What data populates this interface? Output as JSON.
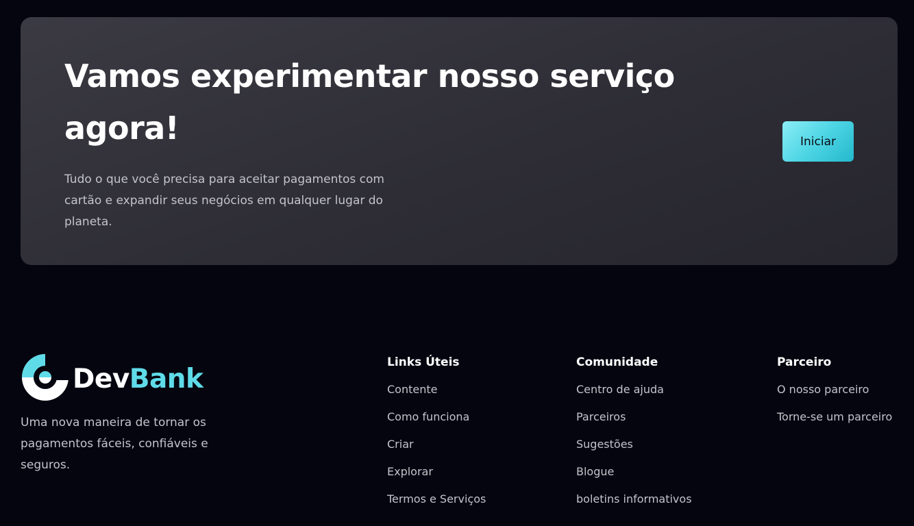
{
  "cta": {
    "title": "Vamos experimentar nosso serviço agora!",
    "description": "Tudo o que você precisa para aceitar pagamentos com cartão e expandir seus negócios em qualquer lugar do planeta.",
    "button_label": "Iniciar"
  },
  "brand": {
    "name_part1": "Dev",
    "name_part2": "Bank",
    "accent_color": "#5fdbe8",
    "logo_icon": "devbank-logo-icon",
    "description": "Uma nova maneira de tornar os pagamentos fáceis, confiáveis e seguros."
  },
  "footer": {
    "links_uteis": {
      "title": "Links Úteis",
      "items": [
        "Contente",
        "Como funciona",
        "Criar",
        "Explorar",
        "Termos e Serviços"
      ]
    },
    "comunidade": {
      "title": "Comunidade",
      "items": [
        "Centro de ajuda",
        "Parceiros",
        "Sugestões",
        "Blogue",
        "boletins informativos"
      ]
    },
    "parceiro": {
      "title": "Parceiro",
      "items": [
        "O nosso parceiro",
        "Torne-se um parceiro"
      ]
    }
  },
  "colors": {
    "background": "#04050f",
    "card": "#35343c",
    "button_gradient_start": "#8beef6",
    "button_gradient_end": "#24b8cc",
    "muted_text": "#c4c4cc"
  }
}
